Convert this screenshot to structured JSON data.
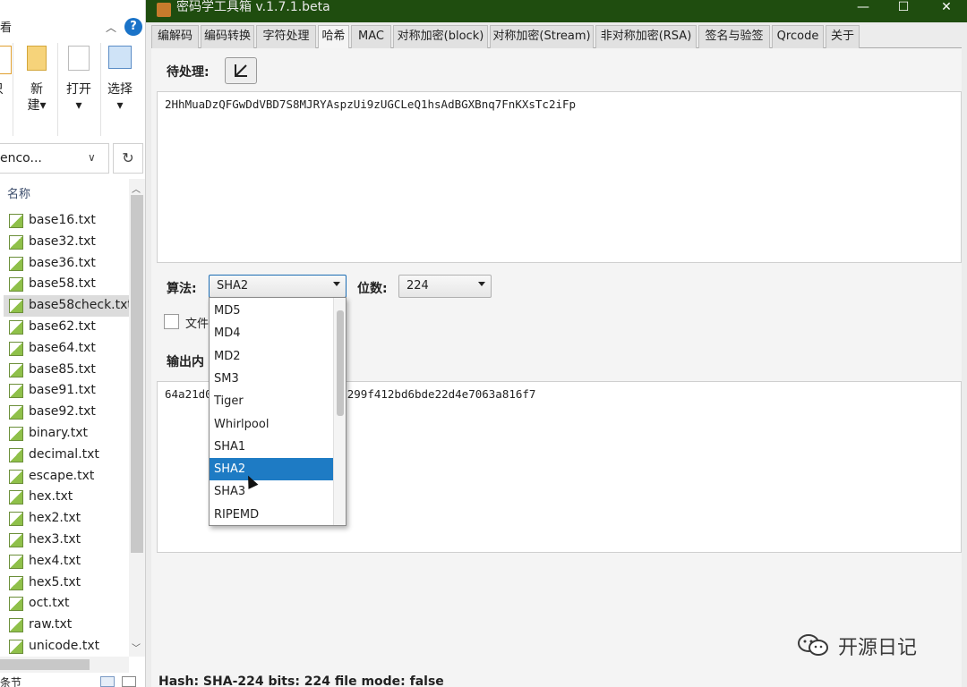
{
  "explorer": {
    "title": "看",
    "ribbon": [
      {
        "label": "只",
        "label2": ""
      },
      {
        "label": "新",
        "label2": "建▾"
      },
      {
        "label": "打开",
        "label2": "▾"
      },
      {
        "label": "选择",
        "label2": "▾"
      }
    ],
    "address": "enco...",
    "column_name": "名称",
    "files": [
      "base16.txt",
      "base32.txt",
      "base36.txt",
      "base58.txt",
      "base58check.txt",
      "base62.txt",
      "base64.txt",
      "base85.txt",
      "base91.txt",
      "base92.txt",
      "binary.txt",
      "decimal.txt",
      "escape.txt",
      "hex.txt",
      "hex2.txt",
      "hex3.txt",
      "hex4.txt",
      "hex5.txt",
      "oct.txt",
      "raw.txt",
      "unicode.txt"
    ],
    "selected_file": "base58check.txt",
    "status_text": "条节"
  },
  "app": {
    "title": "密码学工具箱 v.1.7.1.beta",
    "controls": {
      "minimize": "—",
      "maximize": "☐",
      "close": "✕"
    },
    "tabs": [
      "编解码",
      "编码转换",
      "字符处理",
      "哈希",
      "MAC",
      "对称加密(block)",
      "对称加密(Stream)",
      "非对称加密(RSA)",
      "签名与验签",
      "Qrcode",
      "关于"
    ],
    "active_tab": "哈希",
    "input_label": "待处理:",
    "input_value": "2HhMuaDzQFGwDdVBD7S8MJRYAspzUi9zUGCLeQ1hsAdBGXBnq7FnKXsTc2iFp",
    "algo_label": "算法:",
    "algo_value": "SHA2",
    "bits_label": "位数:",
    "bits_value": "224",
    "file_checkbox_label": "文件",
    "output_label": "输出内",
    "output_value_start": "64a21d0",
    "output_value_end": "12299f412bd6bde22d4e7063a816f7",
    "status": "Hash: SHA-224 bits: 224  file mode: false"
  },
  "dropdown": {
    "options": [
      "MD5",
      "MD4",
      "MD2",
      "SM3",
      "Tiger",
      "Whirlpool",
      "SHA1",
      "SHA2",
      "SHA3",
      "RIPEMD"
    ],
    "selected": "SHA2"
  },
  "watermark": {
    "text": "开源日记"
  }
}
